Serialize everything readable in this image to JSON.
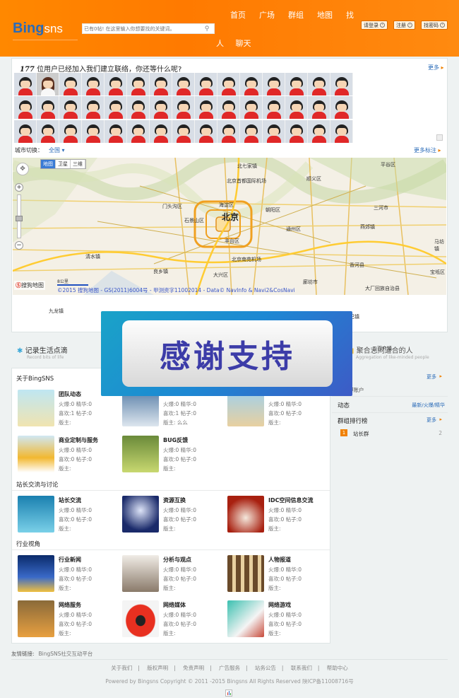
{
  "header": {
    "logo_a": "Bing",
    "logo_b": "sns",
    "search_placeholder": "已有0帖! 在这里输入你想要找的关键词。",
    "nav_row1": [
      "首页",
      "广场",
      "群组",
      "地图",
      "找"
    ],
    "nav_row2": [
      "人",
      "聊天"
    ],
    "btn_login": "请登录",
    "btn_register": "注册",
    "btn_findpw": "找密码"
  },
  "users": {
    "count": "177",
    "prompt": "位用户已经加入我们建立联络，你还等什么呢?",
    "more": "更多",
    "city_label": "城市切换：",
    "city_value": "全国",
    "more_markers": "更多标注"
  },
  "map": {
    "types": [
      "地图",
      "卫星",
      "三维"
    ],
    "center": "北京",
    "labels": [
      "北七家镇",
      "北京首都国际机场",
      "顺义区",
      "平谷区",
      "门头沟区",
      "石景山区",
      "海淀区",
      "朝阳区",
      "通州区",
      "三河市",
      "丰台区",
      "北京南苑机场",
      "大兴区",
      "香河县",
      "宝坻区",
      "廊坊市",
      "燕郊镇",
      "良乡镇",
      "清水镇",
      "九龙镇",
      "马坊镇",
      "五百户镇",
      "大厂回族自治县",
      "东方巴镇"
    ],
    "scale": "8公里",
    "brand": "搜狗地图",
    "copyright": "©2015 搜狗地图 - GS(2011)6004号 - 甲测资字11002014 - Data© NavInfo & Navi2&CosNavi"
  },
  "banner": {
    "record_title": "记录生活点滴",
    "record_sub": "Record bits of life",
    "aggr_title": "聚合志同道合的人",
    "aggr_sub": "Aggregation of like-minded people",
    "overlay_text": "感谢支持"
  },
  "sections": [
    {
      "title": "关于BingSNS",
      "groups": [
        {
          "name": "团队动态",
          "l1": "火爆:0 精华:0",
          "l2": "喜欢:1 帖子:0",
          "l3": "版主:"
        },
        {
          "name": "",
          "l1": "火爆:0 精华:0",
          "l2": "喜欢:1 帖子:0",
          "l3": "版主: 么么"
        },
        {
          "name": "",
          "l1": "火爆:0 精华:0",
          "l2": "喜欢:0 帖子:0",
          "l3": "版主:"
        },
        {
          "name": "商业定制与服务",
          "l1": "火爆:0 精华:0",
          "l2": "喜欢:0 帖子:0",
          "l3": "版主:"
        },
        {
          "name": "BUG反馈",
          "l1": "火爆:0 精华:0",
          "l2": "喜欢:0 帖子:0",
          "l3": "版主:"
        }
      ]
    },
    {
      "title": "站长交流与讨论",
      "groups": [
        {
          "name": "站长交流",
          "l1": "火爆:0 精华:0",
          "l2": "喜欢:0 帖子:0",
          "l3": "版主:"
        },
        {
          "name": "资源互换",
          "l1": "火爆:0 精华:0",
          "l2": "喜欢:0 帖子:0",
          "l3": "版主:"
        },
        {
          "name": "IDC空间信息交流",
          "l1": "火爆:0 精华:0",
          "l2": "喜欢:0 帖子:0",
          "l3": "版主:"
        }
      ]
    },
    {
      "title": "行业视角",
      "groups": [
        {
          "name": "行业新闻",
          "l1": "火爆:0 精华:0",
          "l2": "喜欢:0 帖子:0",
          "l3": "版主:"
        },
        {
          "name": "分析与观点",
          "l1": "火爆:0 精华:0",
          "l2": "喜欢:0 帖子:0",
          "l3": "版主:"
        },
        {
          "name": "人物报道",
          "l1": "火爆:0 精华:0",
          "l2": "喜欢:0 帖子:0",
          "l3": "版主:"
        },
        {
          "name": "网络服务",
          "l1": "火爆:0 精华:0",
          "l2": "喜欢:0 帖子:0",
          "l3": "版主:"
        },
        {
          "name": "网络媒体",
          "l1": "火爆:0 精华:0",
          "l2": "喜欢:0 帖子:0",
          "l3": "版主:"
        },
        {
          "name": "网络游戏",
          "l1": "火爆:0 精华:0",
          "l2": "喜欢:0 帖子:0",
          "l3": "版主:"
        }
      ]
    }
  ],
  "side": {
    "notice_title": "告",
    "notice_more": "更多",
    "notice_item": "定微博账户",
    "dynamic_title": "动态",
    "dynamic_tabs": "最新/火爆/精华",
    "rank_title": "群组排行榜",
    "rank_more": "更多",
    "rank_badge": "1",
    "rank_item": "站长群",
    "rank_count": "2"
  },
  "footer": {
    "links_label": "友情链接:",
    "links_item": "BingSNS社交互动平台",
    "nav": [
      "关于我们",
      "版权声明",
      "免责声明",
      "广告服务",
      "站务公告",
      "联系我们",
      "帮助中心"
    ],
    "copyright": "Powered by Bingsns  Copyright © 2011 -2015 Bingsns All Rights Reserved  陕ICP备11008716号"
  }
}
